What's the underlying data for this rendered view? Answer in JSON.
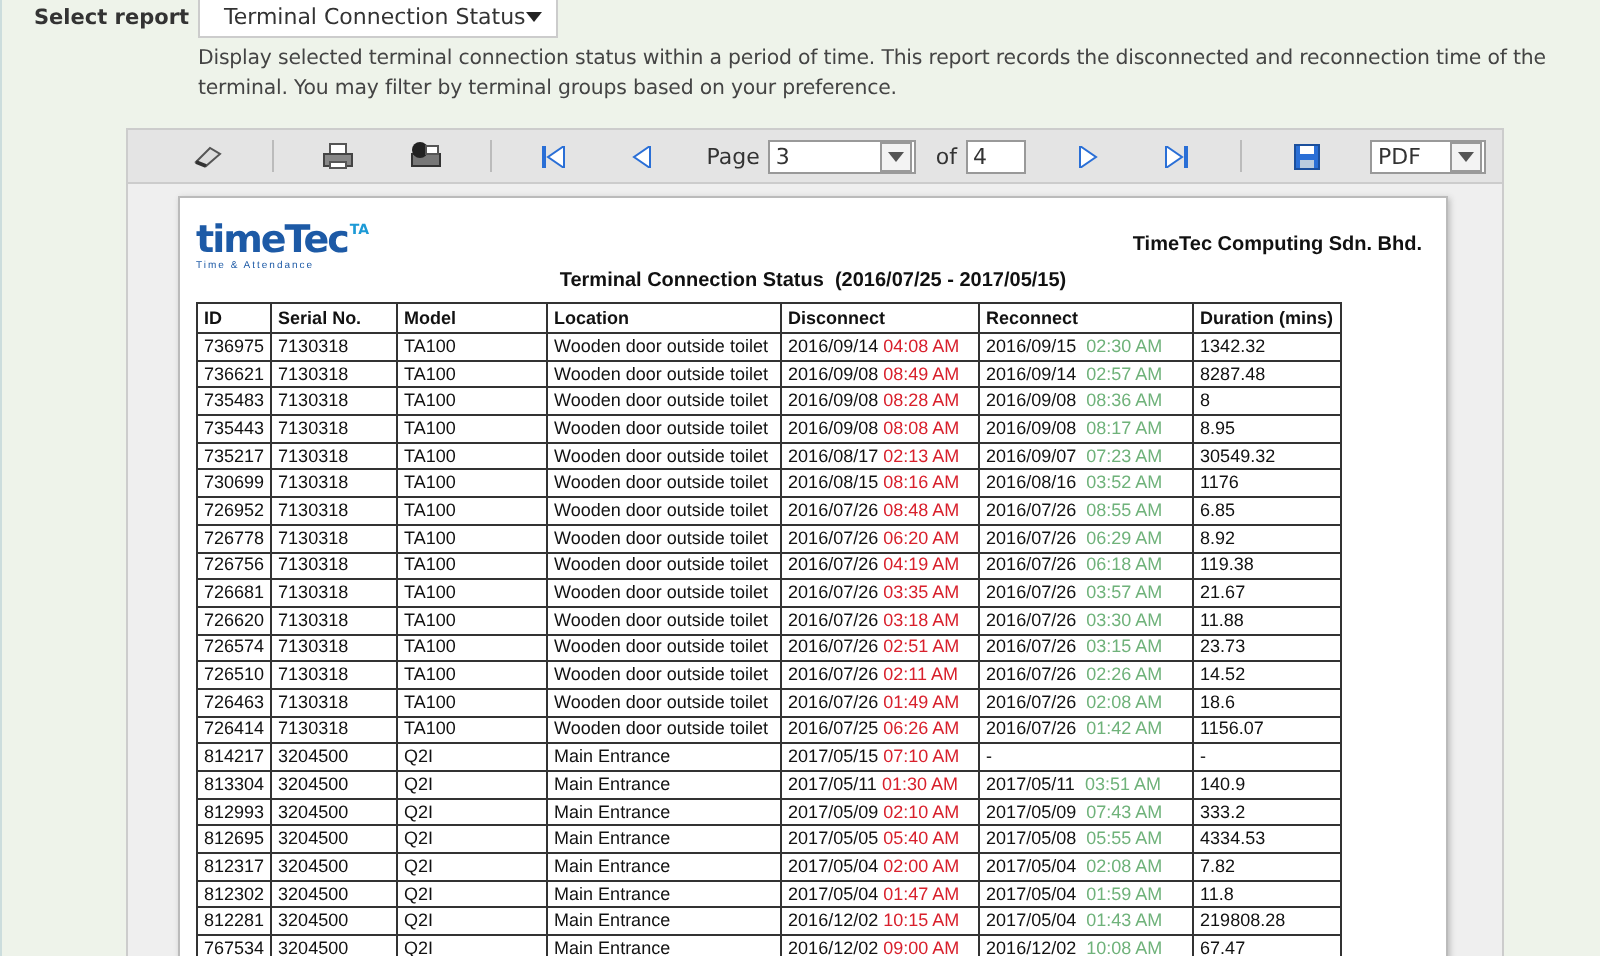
{
  "report_select": {
    "label": "Select report",
    "value": "Terminal Connection Status"
  },
  "description": "Display selected terminal connection status within a period of time. This report records the disconnected and reconnection time of the terminal. You may filter by terminal groups based on your preference.",
  "toolbar": {
    "page_label": "Page",
    "page": "3",
    "of_label": "of",
    "page_count": "4",
    "format": "PDF"
  },
  "document": {
    "logo": {
      "word": "timeTec",
      "badge": "TA",
      "tagline": "Time & Attendance"
    },
    "company": "TimeTec Computing Sdn. Bhd.",
    "title": "Terminal Connection Status  (2016/07/25 - 2017/05/15)",
    "columns": [
      "ID",
      "Serial No.",
      "Model",
      "Location",
      "Disconnect",
      "Reconnect",
      "Duration (mins)"
    ],
    "rows": [
      {
        "id": "736975",
        "serial": "7130318",
        "model": "TA100",
        "location": "Wooden door outside toilet",
        "disconnect_date": "2016/09/14",
        "disconnect_time": "04:08 AM",
        "reconnect_date": "2016/09/15",
        "reconnect_time": "02:30 AM",
        "duration": "1342.32"
      },
      {
        "id": "736621",
        "serial": "7130318",
        "model": "TA100",
        "location": "Wooden door outside toilet",
        "disconnect_date": "2016/09/08",
        "disconnect_time": "08:49 AM",
        "reconnect_date": "2016/09/14",
        "reconnect_time": "02:57 AM",
        "duration": "8287.48"
      },
      {
        "id": "735483",
        "serial": "7130318",
        "model": "TA100",
        "location": "Wooden door outside toilet",
        "disconnect_date": "2016/09/08",
        "disconnect_time": "08:28 AM",
        "reconnect_date": "2016/09/08",
        "reconnect_time": "08:36 AM",
        "duration": "8"
      },
      {
        "id": "735443",
        "serial": "7130318",
        "model": "TA100",
        "location": "Wooden door outside toilet",
        "disconnect_date": "2016/09/08",
        "disconnect_time": "08:08 AM",
        "reconnect_date": "2016/09/08",
        "reconnect_time": "08:17 AM",
        "duration": "8.95"
      },
      {
        "id": "735217",
        "serial": "7130318",
        "model": "TA100",
        "location": "Wooden door outside toilet",
        "disconnect_date": "2016/08/17",
        "disconnect_time": "02:13 AM",
        "reconnect_date": "2016/09/07",
        "reconnect_time": "07:23 AM",
        "duration": "30549.32"
      },
      {
        "id": "730699",
        "serial": "7130318",
        "model": "TA100",
        "location": "Wooden door outside toilet",
        "disconnect_date": "2016/08/15",
        "disconnect_time": "08:16 AM",
        "reconnect_date": "2016/08/16",
        "reconnect_time": "03:52 AM",
        "duration": "1176"
      },
      {
        "id": "726952",
        "serial": "7130318",
        "model": "TA100",
        "location": "Wooden door outside toilet",
        "disconnect_date": "2016/07/26",
        "disconnect_time": "08:48 AM",
        "reconnect_date": "2016/07/26",
        "reconnect_time": "08:55 AM",
        "duration": "6.85"
      },
      {
        "id": "726778",
        "serial": "7130318",
        "model": "TA100",
        "location": "Wooden door outside toilet",
        "disconnect_date": "2016/07/26",
        "disconnect_time": "06:20 AM",
        "reconnect_date": "2016/07/26",
        "reconnect_time": "06:29 AM",
        "duration": "8.92"
      },
      {
        "id": "726756",
        "serial": "7130318",
        "model": "TA100",
        "location": "Wooden door outside toilet",
        "disconnect_date": "2016/07/26",
        "disconnect_time": "04:19 AM",
        "reconnect_date": "2016/07/26",
        "reconnect_time": "06:18 AM",
        "duration": "119.38"
      },
      {
        "id": "726681",
        "serial": "7130318",
        "model": "TA100",
        "location": "Wooden door outside toilet",
        "disconnect_date": "2016/07/26",
        "disconnect_time": "03:35 AM",
        "reconnect_date": "2016/07/26",
        "reconnect_time": "03:57 AM",
        "duration": "21.67"
      },
      {
        "id": "726620",
        "serial": "7130318",
        "model": "TA100",
        "location": "Wooden door outside toilet",
        "disconnect_date": "2016/07/26",
        "disconnect_time": "03:18 AM",
        "reconnect_date": "2016/07/26",
        "reconnect_time": "03:30 AM",
        "duration": "11.88"
      },
      {
        "id": "726574",
        "serial": "7130318",
        "model": "TA100",
        "location": "Wooden door outside toilet",
        "disconnect_date": "2016/07/26",
        "disconnect_time": "02:51 AM",
        "reconnect_date": "2016/07/26",
        "reconnect_time": "03:15 AM",
        "duration": "23.73"
      },
      {
        "id": "726510",
        "serial": "7130318",
        "model": "TA100",
        "location": "Wooden door outside toilet",
        "disconnect_date": "2016/07/26",
        "disconnect_time": "02:11 AM",
        "reconnect_date": "2016/07/26",
        "reconnect_time": "02:26 AM",
        "duration": "14.52"
      },
      {
        "id": "726463",
        "serial": "7130318",
        "model": "TA100",
        "location": "Wooden door outside toilet",
        "disconnect_date": "2016/07/26",
        "disconnect_time": "01:49 AM",
        "reconnect_date": "2016/07/26",
        "reconnect_time": "02:08 AM",
        "duration": "18.6"
      },
      {
        "id": "726414",
        "serial": "7130318",
        "model": "TA100",
        "location": "Wooden door outside toilet",
        "disconnect_date": "2016/07/25",
        "disconnect_time": "06:26 AM",
        "reconnect_date": "2016/07/26",
        "reconnect_time": "01:42 AM",
        "duration": "1156.07"
      },
      {
        "id": "814217",
        "serial": "3204500",
        "model": "Q2I",
        "location": "Main Entrance",
        "disconnect_date": "2017/05/15",
        "disconnect_time": "07:10 AM",
        "reconnect_date": "-",
        "duration": "-"
      },
      {
        "id": "813304",
        "serial": "3204500",
        "model": "Q2I",
        "location": "Main Entrance",
        "disconnect_date": "2017/05/11",
        "disconnect_time": "01:30 AM",
        "reconnect_date": "2017/05/11",
        "reconnect_time": "03:51 AM",
        "duration": "140.9"
      },
      {
        "id": "812993",
        "serial": "3204500",
        "model": "Q2I",
        "location": "Main Entrance",
        "disconnect_date": "2017/05/09",
        "disconnect_time": "02:10 AM",
        "reconnect_date": "2017/05/09",
        "reconnect_time": "07:43 AM",
        "duration": "333.2"
      },
      {
        "id": "812695",
        "serial": "3204500",
        "model": "Q2I",
        "location": "Main Entrance",
        "disconnect_date": "2017/05/05",
        "disconnect_time": "05:40 AM",
        "reconnect_date": "2017/05/08",
        "reconnect_time": "05:55 AM",
        "duration": "4334.53"
      },
      {
        "id": "812317",
        "serial": "3204500",
        "model": "Q2I",
        "location": "Main Entrance",
        "disconnect_date": "2017/05/04",
        "disconnect_time": "02:00 AM",
        "reconnect_date": "2017/05/04",
        "reconnect_time": "02:08 AM",
        "duration": "7.82"
      },
      {
        "id": "812302",
        "serial": "3204500",
        "model": "Q2I",
        "location": "Main Entrance",
        "disconnect_date": "2017/05/04",
        "disconnect_time": "01:47 AM",
        "reconnect_date": "2017/05/04",
        "reconnect_time": "01:59 AM",
        "duration": "11.8"
      },
      {
        "id": "812281",
        "serial": "3204500",
        "model": "Q2I",
        "location": "Main Entrance",
        "disconnect_date": "2016/12/02",
        "disconnect_time": "10:15 AM",
        "reconnect_date": "2017/05/04",
        "reconnect_time": "01:43 AM",
        "duration": "219808.28"
      },
      {
        "id": "767534",
        "serial": "3204500",
        "model": "Q2I",
        "location": "Main Entrance",
        "disconnect_date": "2016/12/02",
        "disconnect_time": "09:00 AM",
        "reconnect_date": "2016/12/02",
        "reconnect_time": "10:08 AM",
        "duration": "67.47"
      }
    ]
  }
}
